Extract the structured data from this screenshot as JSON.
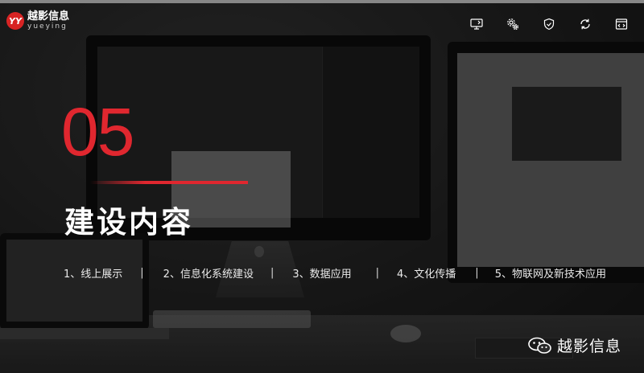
{
  "logo": {
    "mark": "YY",
    "name_cn": "越影信息",
    "name_en": "yueying"
  },
  "top_icons": [
    "monitor-cast-icon",
    "gears-icon",
    "shield-check-icon",
    "sync-icon",
    "code-window-icon"
  ],
  "section": {
    "number": "05",
    "title": "建设内容"
  },
  "items": [
    {
      "label": "1、线上展示"
    },
    {
      "label": "2、信息化系统建设"
    },
    {
      "label": "3、数据应用"
    },
    {
      "label": "4、文化传播"
    },
    {
      "label": "5、物联网及新技术应用"
    }
  ],
  "separator": "|",
  "watermark": {
    "text": "越影信息",
    "icon": "wechat-icon"
  },
  "colors": {
    "accent": "#e0272f",
    "text": "#ffffff"
  }
}
